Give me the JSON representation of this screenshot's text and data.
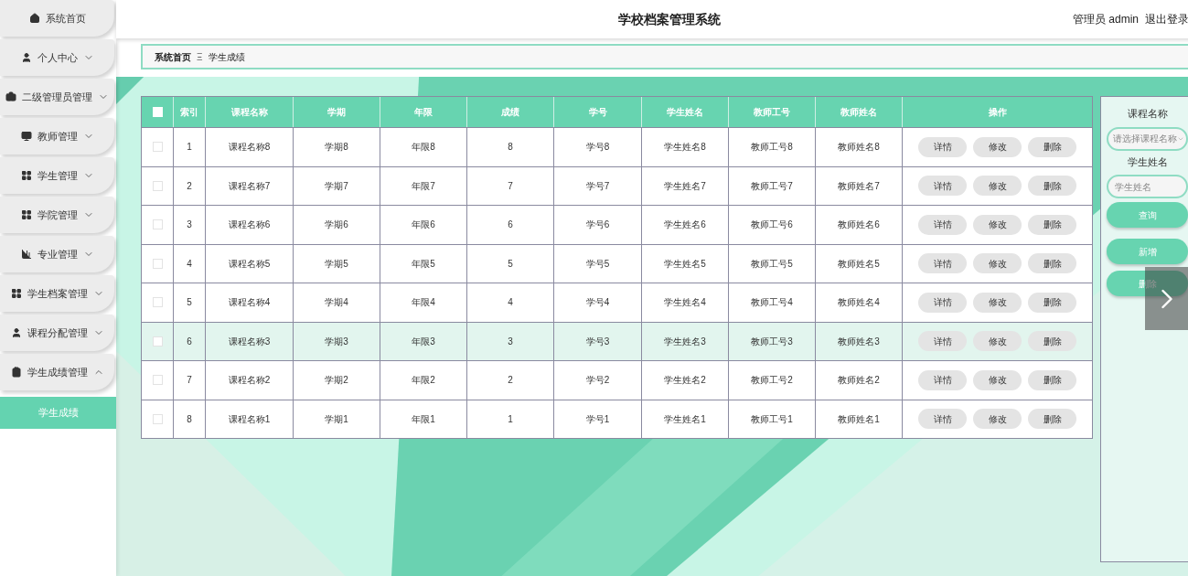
{
  "sidebar": {
    "items": [
      {
        "kind": "home",
        "label": "系统首页"
      },
      {
        "kind": "user",
        "label": "个人中心",
        "expanded": false,
        "has_arrow": true
      },
      {
        "kind": "briefcase",
        "label": "二级管理员管理",
        "expanded": false,
        "has_arrow": true
      },
      {
        "kind": "monitor",
        "label": "教师管理",
        "expanded": false,
        "has_arrow": true
      },
      {
        "kind": "grid",
        "label": "学生管理",
        "expanded": false,
        "has_arrow": true
      },
      {
        "kind": "grid",
        "label": "学院管理",
        "expanded": false,
        "has_arrow": true
      },
      {
        "kind": "chart",
        "label": "专业管理",
        "expanded": false,
        "has_arrow": true
      },
      {
        "kind": "grid",
        "label": "学生档案管理",
        "expanded": false,
        "has_arrow": true
      },
      {
        "kind": "user",
        "label": "课程分配管理",
        "expanded": false,
        "has_arrow": true
      },
      {
        "kind": "clipboard",
        "label": "学生成绩管理",
        "expanded": true,
        "has_arrow": true,
        "children": [
          {
            "label": "学生成绩",
            "selected": true
          }
        ]
      }
    ]
  },
  "header": {
    "title": "学校档案管理系统",
    "user": "管理员 admin",
    "logout": "退出登录"
  },
  "breadcrumb": {
    "home": "系统首页",
    "separator": "Ξ",
    "current": "学生成绩"
  },
  "table": {
    "select_all_checked": false,
    "columns": [
      "索引",
      "课程名称",
      "学期",
      "年限",
      "成绩",
      "学号",
      "学生姓名",
      "教师工号",
      "教师姓名",
      "操作"
    ],
    "rows": [
      {
        "checked": false,
        "hovered": false,
        "cells": [
          "1",
          "课程名称8",
          "学期8",
          "年限8",
          "8",
          "学号8",
          "学生姓名8",
          "教师工号8",
          "教师姓名8"
        ],
        "actions": [
          "详情",
          "修改",
          "删除"
        ]
      },
      {
        "checked": false,
        "hovered": false,
        "cells": [
          "2",
          "课程名称7",
          "学期7",
          "年限7",
          "7",
          "学号7",
          "学生姓名7",
          "教师工号7",
          "教师姓名7"
        ],
        "actions": [
          "详情",
          "修改",
          "删除"
        ]
      },
      {
        "checked": false,
        "hovered": false,
        "cells": [
          "3",
          "课程名称6",
          "学期6",
          "年限6",
          "6",
          "学号6",
          "学生姓名6",
          "教师工号6",
          "教师姓名6"
        ],
        "actions": [
          "详情",
          "修改",
          "删除"
        ]
      },
      {
        "checked": false,
        "hovered": false,
        "cells": [
          "4",
          "课程名称5",
          "学期5",
          "年限5",
          "5",
          "学号5",
          "学生姓名5",
          "教师工号5",
          "教师姓名5"
        ],
        "actions": [
          "详情",
          "修改",
          "删除"
        ]
      },
      {
        "checked": false,
        "hovered": false,
        "cells": [
          "5",
          "课程名称4",
          "学期4",
          "年限4",
          "4",
          "学号4",
          "学生姓名4",
          "教师工号4",
          "教师姓名4"
        ],
        "actions": [
          "详情",
          "修改",
          "删除"
        ]
      },
      {
        "checked": false,
        "hovered": true,
        "cells": [
          "6",
          "课程名称3",
          "学期3",
          "年限3",
          "3",
          "学号3",
          "学生姓名3",
          "教师工号3",
          "教师姓名3"
        ],
        "actions": [
          "详情",
          "修改",
          "删除"
        ]
      },
      {
        "checked": false,
        "hovered": false,
        "cells": [
          "7",
          "课程名称2",
          "学期2",
          "年限2",
          "2",
          "学号2",
          "学生姓名2",
          "教师工号2",
          "教师姓名2"
        ],
        "actions": [
          "详情",
          "修改",
          "删除"
        ]
      },
      {
        "checked": false,
        "hovered": false,
        "cells": [
          "8",
          "课程名称1",
          "学期1",
          "年限1",
          "1",
          "学号1",
          "学生姓名1",
          "教师工号1",
          "教师姓名1"
        ],
        "actions": [
          "详情",
          "修改",
          "删除"
        ]
      }
    ]
  },
  "search_panel": {
    "fields": [
      {
        "kind": "select",
        "label": "课程名称",
        "placeholder": "请选择课程名称"
      },
      {
        "kind": "text",
        "label": "学生姓名",
        "placeholder": "学生姓名"
      }
    ],
    "buttons": [
      "查询",
      "新增",
      "删除"
    ]
  }
}
